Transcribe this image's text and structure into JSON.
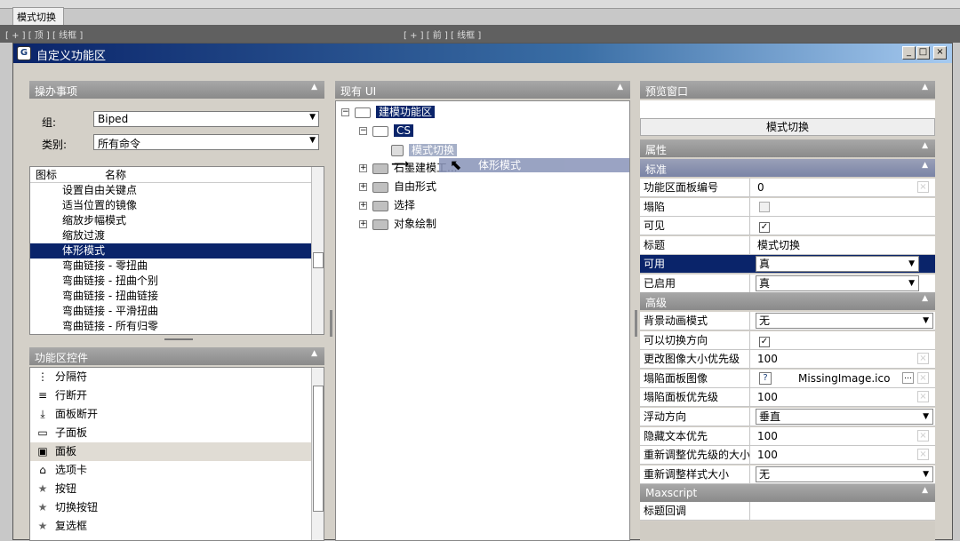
{
  "background_app": {
    "mode_tab": "模式切换",
    "viewport_labels": [
      "[ + ] [ 顶 ] [ 线框 ]",
      "[ + ] [ 前 ] [ 线框 ]"
    ]
  },
  "dialog": {
    "title": "自定义功能区",
    "window_buttons": [
      "_",
      "□",
      "×"
    ]
  },
  "actions_panel": {
    "header": "操办事项",
    "group_label": "组:",
    "group_value": "Biped",
    "category_label": "类别:",
    "category_value": "所有命令",
    "col_icon": "图标",
    "col_name": "名称",
    "items": [
      "设置自由关键点",
      "适当位置的镜像",
      "缩放步幅模式",
      "缩放过渡",
      "体形模式",
      "弯曲链接 - 零扭曲",
      "弯曲链接 - 扭曲个别",
      "弯曲链接 - 扭曲链接",
      "弯曲链接 - 平滑扭曲",
      "弯曲链接 - 所有归零"
    ],
    "selected_index": 4
  },
  "controls_panel": {
    "header": "功能区控件",
    "items": [
      {
        "icon": "separator-icon",
        "label": "分隔符"
      },
      {
        "icon": "row-break-icon",
        "label": "行断开"
      },
      {
        "icon": "panel-break-icon",
        "label": "面板断开"
      },
      {
        "icon": "sub-panel-icon",
        "label": "子面板"
      },
      {
        "icon": "panel-icon",
        "label": "面板"
      },
      {
        "icon": "tab-icon",
        "label": "选项卡"
      },
      {
        "icon": "star-icon",
        "label": "按钮"
      },
      {
        "icon": "star-icon",
        "label": "切换按钮"
      },
      {
        "icon": "star-icon",
        "label": "复选框"
      }
    ],
    "highlighted_index": 4
  },
  "existing_ui": {
    "header": "现有 UI",
    "root": "建模功能区",
    "cs": "CS",
    "mode_switch": "模式切换",
    "children": [
      "石墨建模工...",
      "自由形式",
      "选择",
      "对象绘制"
    ],
    "drag_label": "体形模式"
  },
  "preview": {
    "header": "预览窗口",
    "button": "模式切换"
  },
  "properties": {
    "header": "属性",
    "standard_header": "标准",
    "advanced_header": "高级",
    "maxscript_header": "Maxscript",
    "standard_rows": [
      {
        "key": "功能区面板编号",
        "value": "0"
      },
      {
        "key": "塌陷",
        "value": ""
      },
      {
        "key": "可见",
        "value": "✓"
      },
      {
        "key": "标题",
        "value": "模式切换"
      },
      {
        "key": "可用",
        "value": "真"
      },
      {
        "key": "已启用",
        "value": "真"
      }
    ],
    "advanced_rows": [
      {
        "key": "背景动画模式",
        "value": "无"
      },
      {
        "key": "可以切换方向",
        "value": "✓"
      },
      {
        "key": "更改图像大小优先级",
        "value": "100"
      },
      {
        "key": "塌陷面板图像",
        "value": "MissingImage.ico"
      },
      {
        "key": "塌陷面板优先级",
        "value": "100"
      },
      {
        "key": "浮动方向",
        "value": "垂直"
      },
      {
        "key": "隐藏文本优先",
        "value": "100"
      },
      {
        "key": "重新调整优先级的大小",
        "value": "100"
      },
      {
        "key": "重新调整样式大小",
        "value": "无"
      }
    ],
    "maxscript_rows": [
      {
        "key": "标题回调",
        "value": ""
      }
    ]
  },
  "colors": {
    "selection": "#0a246a",
    "panel_header": "#9a9a9a"
  }
}
